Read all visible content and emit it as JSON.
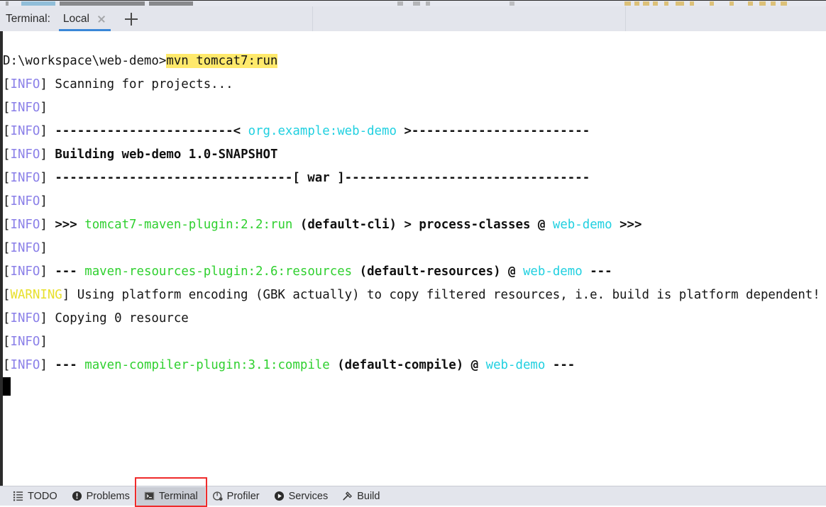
{
  "window": {
    "tool_window": "Terminal"
  },
  "header": {
    "label": "Terminal:",
    "tabs": [
      {
        "name": "Local",
        "active": true,
        "close_icon": "close-icon"
      }
    ],
    "add_tab_icon": "plus-icon"
  },
  "terminal": {
    "prompt": "D:\\workspace\\web-demo>",
    "command": "mvn tomcat7:run",
    "lines": [
      {
        "id": "cmd-line",
        "segments": [
          {
            "text": "D:\\workspace\\web-demo>",
            "style": "plain"
          },
          {
            "text": "mvn tomcat7:run",
            "style": "highlight"
          }
        ]
      },
      {
        "id": "scanning",
        "segments": [
          {
            "text": "[",
            "style": "plain"
          },
          {
            "text": "INFO",
            "style": "info"
          },
          {
            "text": "] Scanning for projects...",
            "style": "plain"
          }
        ]
      },
      {
        "id": "info-blank-1",
        "segments": [
          {
            "text": "[",
            "style": "plain"
          },
          {
            "text": "INFO",
            "style": "info"
          },
          {
            "text": "] ",
            "style": "plain"
          }
        ]
      },
      {
        "id": "project-banner",
        "segments": [
          {
            "text": "[",
            "style": "plain"
          },
          {
            "text": "INFO",
            "style": "info"
          },
          {
            "text": "] ",
            "style": "plain"
          },
          {
            "text": "------------------------< ",
            "style": "bold"
          },
          {
            "text": "org.example:web-demo",
            "style": "cyan"
          },
          {
            "text": " >------------------------",
            "style": "bold"
          }
        ]
      },
      {
        "id": "building",
        "segments": [
          {
            "text": "[",
            "style": "plain"
          },
          {
            "text": "INFO",
            "style": "info"
          },
          {
            "text": "] ",
            "style": "plain"
          },
          {
            "text": "Building web-demo 1.0-SNAPSHOT",
            "style": "bold"
          }
        ]
      },
      {
        "id": "packaging-banner",
        "segments": [
          {
            "text": "[",
            "style": "plain"
          },
          {
            "text": "INFO",
            "style": "info"
          },
          {
            "text": "] ",
            "style": "plain"
          },
          {
            "text": "--------------------------------[ war ]---------------------------------",
            "style": "bold"
          }
        ]
      },
      {
        "id": "info-blank-2",
        "segments": [
          {
            "text": "[",
            "style": "plain"
          },
          {
            "text": "INFO",
            "style": "info"
          },
          {
            "text": "] ",
            "style": "plain"
          }
        ]
      },
      {
        "id": "tomcat7-run",
        "segments": [
          {
            "text": "[",
            "style": "plain"
          },
          {
            "text": "INFO",
            "style": "info"
          },
          {
            "text": "] ",
            "style": "plain"
          },
          {
            "text": ">>> ",
            "style": "bold"
          },
          {
            "text": "tomcat7-maven-plugin:2.2:run",
            "style": "green"
          },
          {
            "text": " (default-cli) > process-classes @ ",
            "style": "bold"
          },
          {
            "text": "web-demo",
            "style": "cyan"
          },
          {
            "text": " >>>",
            "style": "bold"
          }
        ]
      },
      {
        "id": "info-blank-3",
        "segments": [
          {
            "text": "[",
            "style": "plain"
          },
          {
            "text": "INFO",
            "style": "info"
          },
          {
            "text": "] ",
            "style": "plain"
          }
        ]
      },
      {
        "id": "resources-plugin",
        "segments": [
          {
            "text": "[",
            "style": "plain"
          },
          {
            "text": "INFO",
            "style": "info"
          },
          {
            "text": "] ",
            "style": "plain"
          },
          {
            "text": "--- ",
            "style": "bold"
          },
          {
            "text": "maven-resources-plugin:2.6:resources",
            "style": "green"
          },
          {
            "text": " (default-resources) @ ",
            "style": "bold"
          },
          {
            "text": "web-demo",
            "style": "cyan"
          },
          {
            "text": " ---",
            "style": "bold"
          }
        ]
      },
      {
        "id": "warning-encoding",
        "segments": [
          {
            "text": "[",
            "style": "plain"
          },
          {
            "text": "WARNING",
            "style": "warning"
          },
          {
            "text": "] Using platform encoding (GBK actually) to copy filtered resources, i.e. build is platform dependent!",
            "style": "plain"
          }
        ]
      },
      {
        "id": "copying",
        "segments": [
          {
            "text": "[",
            "style": "plain"
          },
          {
            "text": "INFO",
            "style": "info"
          },
          {
            "text": "] Copying 0 resource",
            "style": "plain"
          }
        ]
      },
      {
        "id": "info-blank-4",
        "segments": [
          {
            "text": "[",
            "style": "plain"
          },
          {
            "text": "INFO",
            "style": "info"
          },
          {
            "text": "] ",
            "style": "plain"
          }
        ]
      },
      {
        "id": "compiler-plugin",
        "segments": [
          {
            "text": "[",
            "style": "plain"
          },
          {
            "text": "INFO",
            "style": "info"
          },
          {
            "text": "] ",
            "style": "plain"
          },
          {
            "text": "--- ",
            "style": "bold"
          },
          {
            "text": "maven-compiler-plugin:3.1:compile",
            "style": "green"
          },
          {
            "text": " (default-compile) @ ",
            "style": "bold"
          },
          {
            "text": "web-demo",
            "style": "cyan"
          },
          {
            "text": " ---",
            "style": "bold"
          }
        ]
      }
    ],
    "cursor": "block"
  },
  "bottom_bar": {
    "items": [
      {
        "label": "TODO",
        "icon": "list-icon",
        "selected": false
      },
      {
        "label": "Problems",
        "icon": "error-icon",
        "selected": false
      },
      {
        "label": "Terminal",
        "icon": "terminal-icon",
        "selected": true
      },
      {
        "label": "Profiler",
        "icon": "profiler-icon",
        "selected": false
      },
      {
        "label": "Services",
        "icon": "play-icon",
        "selected": false
      },
      {
        "label": "Build",
        "icon": "hammer-icon",
        "selected": false
      }
    ]
  },
  "annotation": {
    "target": "Terminal",
    "color": "#ef2b2b"
  },
  "colors": {
    "info": "#8a7fe8",
    "warning": "#e8e02c",
    "green": "#2fd02f",
    "cyan": "#20d0e0",
    "highlight": "#ffe96b",
    "accent": "#3a87d8",
    "annotation": "#ef2b2b"
  }
}
